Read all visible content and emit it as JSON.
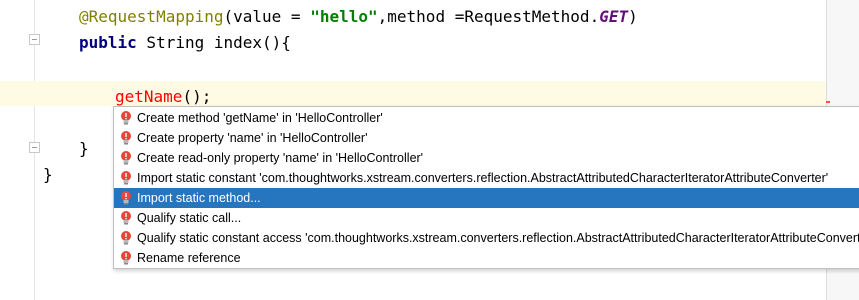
{
  "code": {
    "line1": {
      "annotation": "@RequestMapping",
      "open": "(value = ",
      "string": "\"hello\"",
      "mid": ",method =RequestMethod.",
      "constant": "GET",
      "close": ")"
    },
    "line2": {
      "keyword": "public",
      "rest": " String index(){"
    },
    "line3": {
      "error_call": "getName",
      "rest": "();"
    },
    "line4": {
      "brace": "}"
    },
    "line5": {
      "brace": "}"
    }
  },
  "popup": {
    "items": [
      {
        "label": "Create method 'getName' in 'HelloController'"
      },
      {
        "label": "Create property 'name' in 'HelloController'"
      },
      {
        "label": "Create read-only property 'name' in 'HelloController'"
      },
      {
        "label": "Import static constant 'com.thoughtworks.xstream.converters.reflection.AbstractAttributedCharacterIteratorAttributeConverter'"
      },
      {
        "label": "Import static method..."
      },
      {
        "label": "Qualify static call..."
      },
      {
        "label": "Qualify static constant access 'com.thoughtworks.xstream.converters.reflection.AbstractAttributedCharacterIteratorAttributeConverter'"
      },
      {
        "label": "Rename reference"
      }
    ],
    "selected_index": 4,
    "icon": "error-lightbulb-icon"
  },
  "colors": {
    "selection": "#2675bf",
    "caret_line": "#fffae3",
    "annotation": "#808000",
    "string": "#008000",
    "keyword": "#000080",
    "error": "#ff0000"
  }
}
